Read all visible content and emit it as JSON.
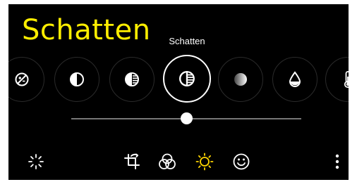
{
  "caption": "Schatten",
  "selected_tool_label": "Schatten",
  "tools": [
    {
      "icon": "exposure-off-icon"
    },
    {
      "icon": "contrast-icon"
    },
    {
      "icon": "highlights-icon"
    },
    {
      "icon": "shadows-icon",
      "selected": true
    },
    {
      "icon": "gradient-icon"
    },
    {
      "icon": "saturation-drop-icon"
    },
    {
      "icon": "temperature-icon"
    }
  ],
  "slider": {
    "value": 0.5
  },
  "bottom_bar": [
    "auto-enhance-icon",
    "crop-rotate-icon",
    "filters-icon",
    "adjust-light-icon",
    "face-icon",
    "more-options-icon"
  ],
  "colors": {
    "background": "#000000",
    "caption": "#ffee00",
    "accent": "#ffd600",
    "icon": "#ffffff"
  }
}
